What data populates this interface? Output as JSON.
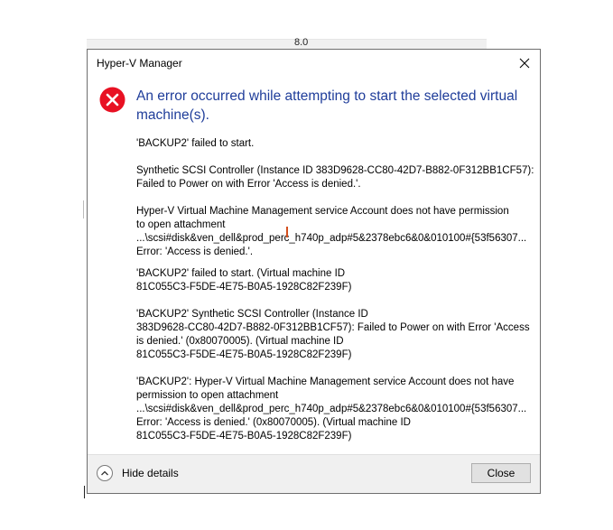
{
  "background": {
    "strip_text": "8.0"
  },
  "dialog": {
    "title": "Hyper-V Manager",
    "main_instruction": "An error occurred while attempting to start the selected virtual machine(s).",
    "paragraphs": [
      {
        "lines": [
          "'BACKUP2' failed to start."
        ]
      },
      {
        "lines": [
          "Synthetic SCSI Controller (Instance ID 383D9628-CC80-42D7-B882-0F312BB1CF57):",
          "Failed to Power on with Error 'Access is denied.'."
        ]
      },
      {
        "lines": [
          "Hyper-V Virtual Machine Management service Account does not have permission",
          "to open attachment",
          "...\\scsi#disk&ven_dell&prod_perc_h740p_adp#5&2378ebc6&0&010100#{53f56307...",
          "Error: 'Access is denied.'."
        ]
      },
      {
        "lines": [
          "'BACKUP2' failed to start. (Virtual machine ID",
          "81C055C3-F5DE-4E75-B0A5-1928C82F239F)"
        ]
      },
      {
        "lines": [
          "'BACKUP2' Synthetic SCSI Controller (Instance ID",
          "383D9628-CC80-42D7-B882-0F312BB1CF57): Failed to Power on with Error 'Access",
          "is denied.' (0x80070005). (Virtual machine ID",
          "81C055C3-F5DE-4E75-B0A5-1928C82F239F)"
        ]
      },
      {
        "lines": [
          "'BACKUP2': Hyper-V Virtual Machine Management service Account does not have",
          "permission to open attachment",
          "...\\scsi#disk&ven_dell&prod_perc_h740p_adp#5&2378ebc6&0&010100#{53f56307...",
          "Error: 'Access is denied.' (0x80070005). (Virtual machine ID",
          "81C055C3-F5DE-4E75-B0A5-1928C82F239F)"
        ]
      }
    ],
    "footer": {
      "details_toggle_label": "Hide details",
      "close_button_label": "Close"
    },
    "icons": {
      "titlebar_close": "close-icon",
      "status": "error-icon",
      "details_toggle": "chevron-up-icon"
    },
    "colors": {
      "instruction_text": "#1f3d9a",
      "error_icon": "#e81123"
    }
  }
}
